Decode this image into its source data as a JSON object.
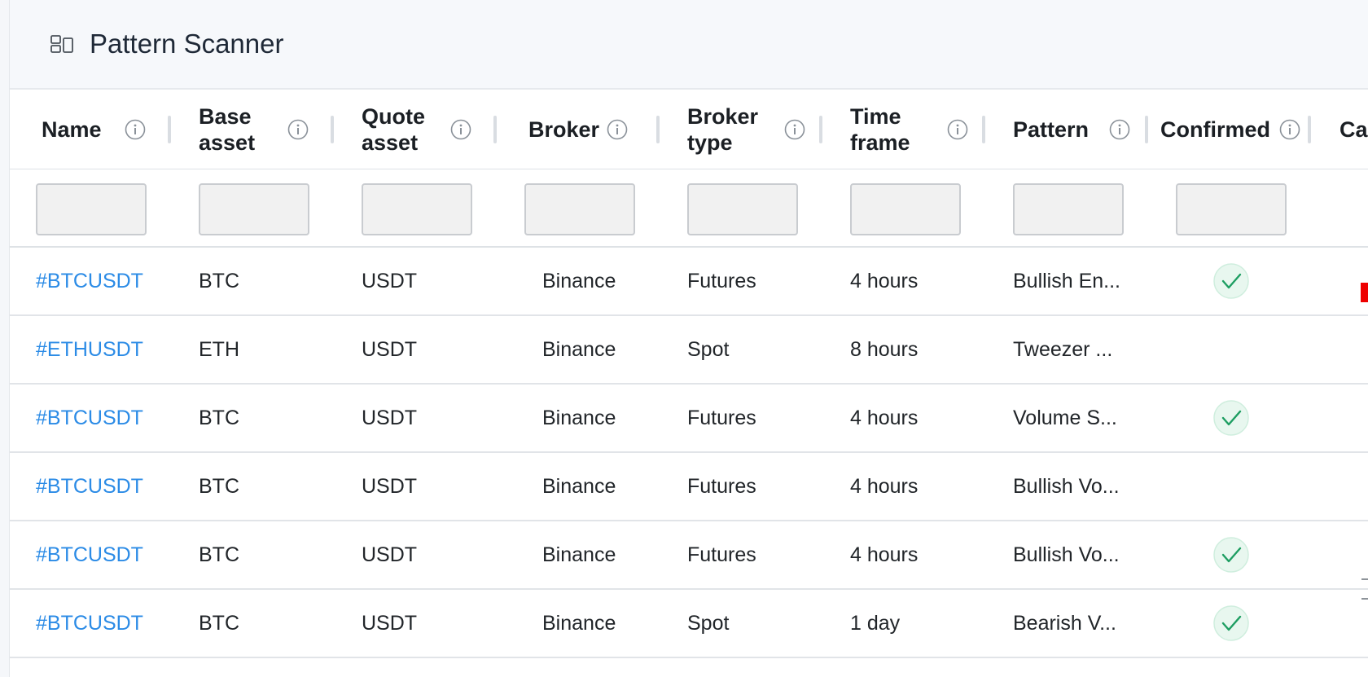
{
  "panel": {
    "title": "Pattern Scanner"
  },
  "columns": [
    {
      "label": "Name"
    },
    {
      "label": "Base asset"
    },
    {
      "label": "Quote asset"
    },
    {
      "label": "Broker"
    },
    {
      "label": "Broker type"
    },
    {
      "label": "Time frame"
    },
    {
      "label": "Pattern"
    },
    {
      "label": "Confirmed"
    },
    {
      "label": "Ca"
    }
  ],
  "rows": [
    {
      "name": "#BTCUSDT",
      "base": "BTC",
      "quote": "USDT",
      "broker": "Binance",
      "broker_type": "Futures",
      "time_frame": "4 hours",
      "pattern": "Bullish En...",
      "confirmed": true
    },
    {
      "name": "#ETHUSDT",
      "base": "ETH",
      "quote": "USDT",
      "broker": "Binance",
      "broker_type": "Spot",
      "time_frame": "8 hours",
      "pattern": "Tweezer ...",
      "confirmed": false
    },
    {
      "name": "#BTCUSDT",
      "base": "BTC",
      "quote": "USDT",
      "broker": "Binance",
      "broker_type": "Futures",
      "time_frame": "4 hours",
      "pattern": "Volume S...",
      "confirmed": true
    },
    {
      "name": "#BTCUSDT",
      "base": "BTC",
      "quote": "USDT",
      "broker": "Binance",
      "broker_type": "Futures",
      "time_frame": "4 hours",
      "pattern": "Bullish Vo...",
      "confirmed": false
    },
    {
      "name": "#BTCUSDT",
      "base": "BTC",
      "quote": "USDT",
      "broker": "Binance",
      "broker_type": "Futures",
      "time_frame": "4 hours",
      "pattern": "Bullish Vo...",
      "confirmed": true
    },
    {
      "name": "#BTCUSDT",
      "base": "BTC",
      "quote": "USDT",
      "broker": "Binance",
      "broker_type": "Spot",
      "time_frame": "1 day",
      "pattern": "Bearish V...",
      "confirmed": true
    }
  ],
  "colors": {
    "link": "#2b8be6",
    "check_bg": "#e8f7ef",
    "check_stroke": "#1e9e62",
    "edge_indicator": "#ee0000"
  },
  "icons": {
    "header": "layout-grid-icon",
    "column_info": "info-circle-icon",
    "confirmed": "check-badge-icon"
  }
}
